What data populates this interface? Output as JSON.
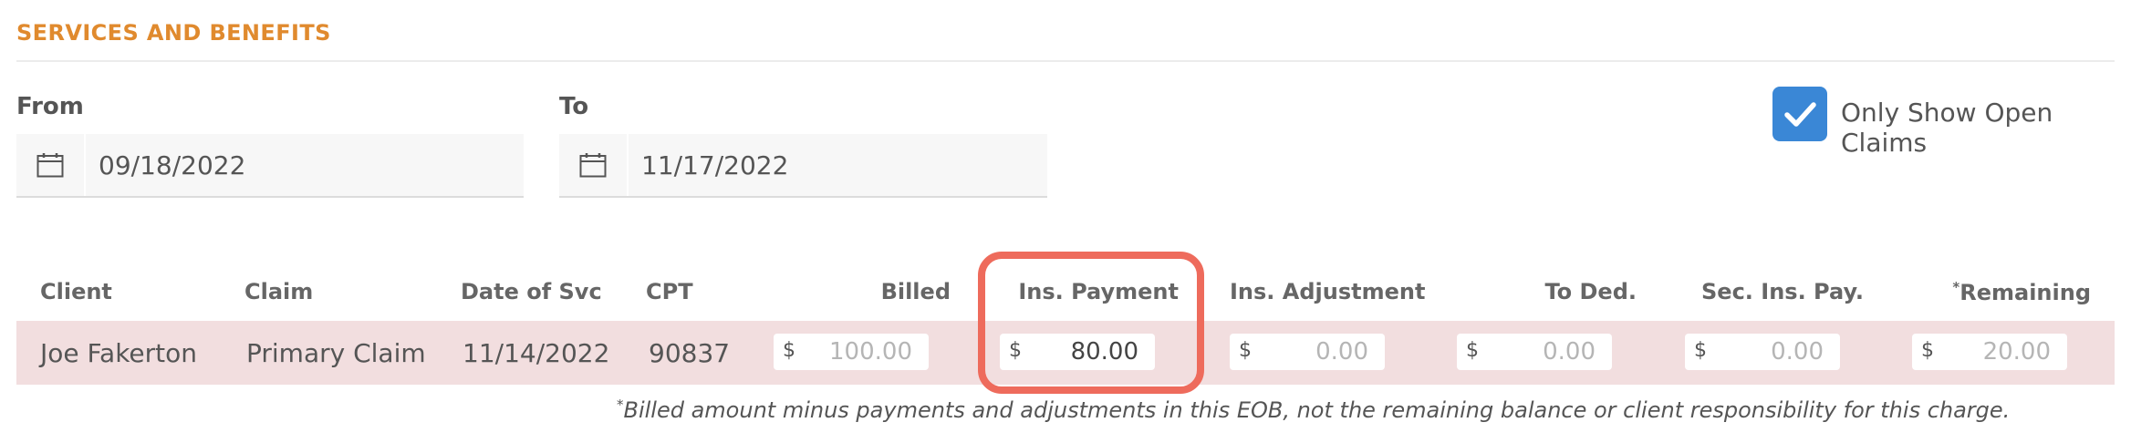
{
  "section": {
    "title": "SERVICES AND BENEFITS"
  },
  "filters": {
    "from": {
      "label": "From",
      "value": "09/18/2022",
      "icon": "calendar-icon"
    },
    "to": {
      "label": "To",
      "value": "11/17/2022",
      "icon": "calendar-icon"
    },
    "only_open": {
      "label": "Only Show Open Claims",
      "checked": true,
      "color": "#3a87d6"
    }
  },
  "table": {
    "columns": {
      "client": "Client",
      "claim": "Claim",
      "date": "Date of Svc",
      "cpt": "CPT",
      "billed": "Billed",
      "ins_payment": "Ins. Payment",
      "ins_adjustment": "Ins. Adjustment",
      "to_ded": "To Ded.",
      "sec_ins_pay": "Sec. Ins. Pay.",
      "remaining_mark": "*",
      "remaining": "Remaining"
    },
    "row": {
      "client": "Joe Fakerton",
      "claim": "Primary Claim",
      "date": "11/14/2022",
      "cpt": "90837",
      "currency": "$",
      "billed": "100.00",
      "ins_payment": "80.00",
      "ins_adjustment": "0.00",
      "to_ded": "0.00",
      "sec_ins_pay": "0.00",
      "remaining": "20.00"
    }
  },
  "footnote": {
    "mark": "*",
    "text": "Billed amount minus payments and adjustments in this EOB, not the remaining balance or client responsibility for this charge."
  },
  "colors": {
    "accent": "#e08a2e",
    "row_highlight": "#f2dedf",
    "focus_ring": "#ee6b5c",
    "checkbox": "#3a87d6"
  }
}
